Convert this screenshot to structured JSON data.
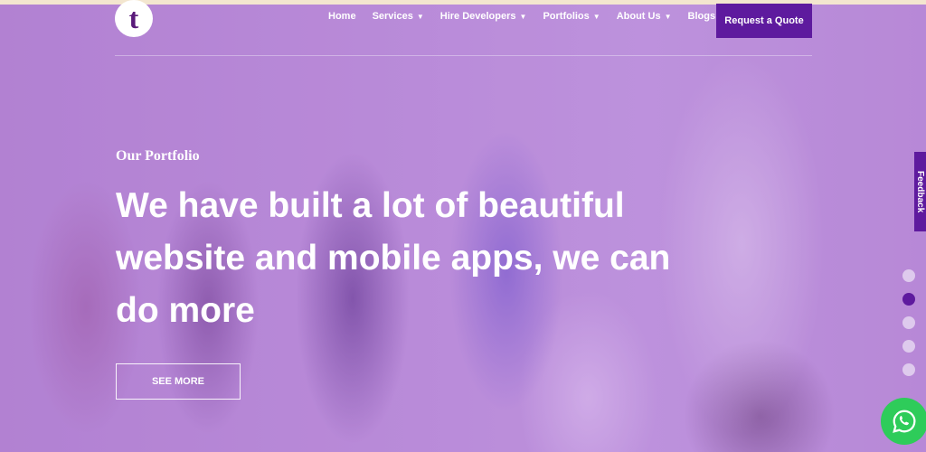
{
  "brand": {
    "logo_letter": "t"
  },
  "nav": {
    "items": [
      {
        "label": "Home",
        "has_dropdown": false
      },
      {
        "label": "Services",
        "has_dropdown": true
      },
      {
        "label": "Hire Developers",
        "has_dropdown": true
      },
      {
        "label": "Portfolios",
        "has_dropdown": true
      },
      {
        "label": "About Us",
        "has_dropdown": true
      },
      {
        "label": "Blogs",
        "has_dropdown": true
      }
    ],
    "cta_label": "Request a Quote"
  },
  "hero": {
    "eyebrow": "Our Portfolio",
    "headline": "We have built a lot of beautiful website and mobile apps, we can do more",
    "button_label": "SEE MORE"
  },
  "feedback": {
    "label": "Feedback"
  },
  "slider": {
    "count": 5,
    "active_index": 1
  },
  "icons": {
    "chevron": "chevron-down-icon",
    "whatsapp": "whatsapp-icon"
  },
  "colors": {
    "accent": "#5e1a9e",
    "overlay": "#b98fd6",
    "whatsapp": "#2ecc5a"
  }
}
